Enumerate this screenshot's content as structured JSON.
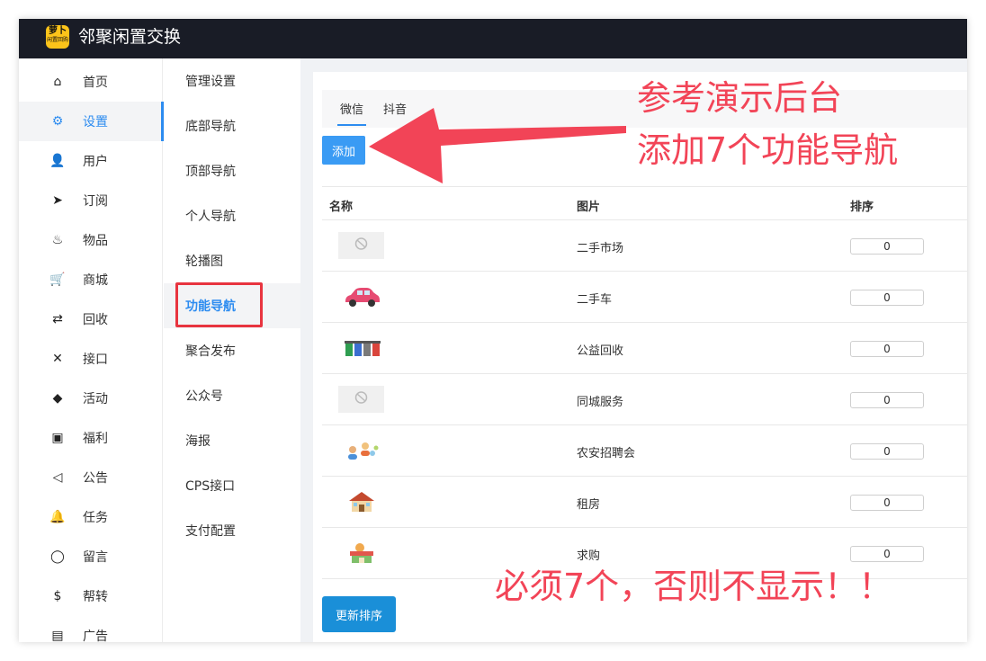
{
  "app": {
    "title": "邻聚闲置交换",
    "logo_top": "萝卜",
    "logo_bottom": "闲置回购"
  },
  "sidebar": {
    "items": [
      {
        "label": "首页",
        "icon": "home-icon",
        "glyph": "⌂"
      },
      {
        "label": "设置",
        "icon": "gear-icon",
        "glyph": "⚙"
      },
      {
        "label": "用户",
        "icon": "user-icon",
        "glyph": "👤"
      },
      {
        "label": "订阅",
        "icon": "paper-plane-icon",
        "glyph": "➤"
      },
      {
        "label": "物品",
        "icon": "fire-icon",
        "glyph": "♨"
      },
      {
        "label": "商城",
        "icon": "cart-icon",
        "glyph": "🛒"
      },
      {
        "label": "回收",
        "icon": "shuffle-icon",
        "glyph": "⇄"
      },
      {
        "label": "接口",
        "icon": "tools-icon",
        "glyph": "✕"
      },
      {
        "label": "活动",
        "icon": "diamond-icon",
        "glyph": "◆"
      },
      {
        "label": "福利",
        "icon": "gift-icon",
        "glyph": "▣"
      },
      {
        "label": "公告",
        "icon": "speaker-icon",
        "glyph": "◁"
      },
      {
        "label": "任务",
        "icon": "bell-icon",
        "glyph": "🔔"
      },
      {
        "label": "留言",
        "icon": "chat-icon",
        "glyph": "◯"
      },
      {
        "label": "帮转",
        "icon": "dollar-icon",
        "glyph": "$"
      },
      {
        "label": "广告",
        "icon": "clipboard-icon",
        "glyph": "▤"
      }
    ]
  },
  "subnav": {
    "items": [
      "管理设置",
      "底部导航",
      "顶部导航",
      "个人导航",
      "轮播图",
      "功能导航",
      "聚合发布",
      "公众号",
      "海报",
      "CPS接口",
      "支付配置"
    ]
  },
  "tabs": [
    "微信",
    "抖音"
  ],
  "add_label": "添加",
  "table": {
    "headers": {
      "name": "名称",
      "image": "图片",
      "order": "排序"
    },
    "rows": [
      {
        "name": "二手市场",
        "order": "0",
        "image": "placeholder-image"
      },
      {
        "name": "二手车",
        "order": "0",
        "image": "car-icon"
      },
      {
        "name": "公益回收",
        "order": "0",
        "image": "recycle-bins-icon"
      },
      {
        "name": "同城服务",
        "order": "0",
        "image": "placeholder-image"
      },
      {
        "name": "农安招聘会",
        "order": "0",
        "image": "people-icon"
      },
      {
        "name": "租房",
        "order": "0",
        "image": "house-icon"
      },
      {
        "name": "求购",
        "order": "0",
        "image": "shop-icon"
      }
    ]
  },
  "update_label": "更新排序",
  "annotations": {
    "line1": "参考演示后台",
    "line2": "添加7个功能导航",
    "line3": "必须7个，否则不显示！！"
  },
  "colors": {
    "accent": "#2d8cf0",
    "annotation": "#f24457",
    "topbar": "#191c26",
    "highlight_box": "#e8343f"
  }
}
